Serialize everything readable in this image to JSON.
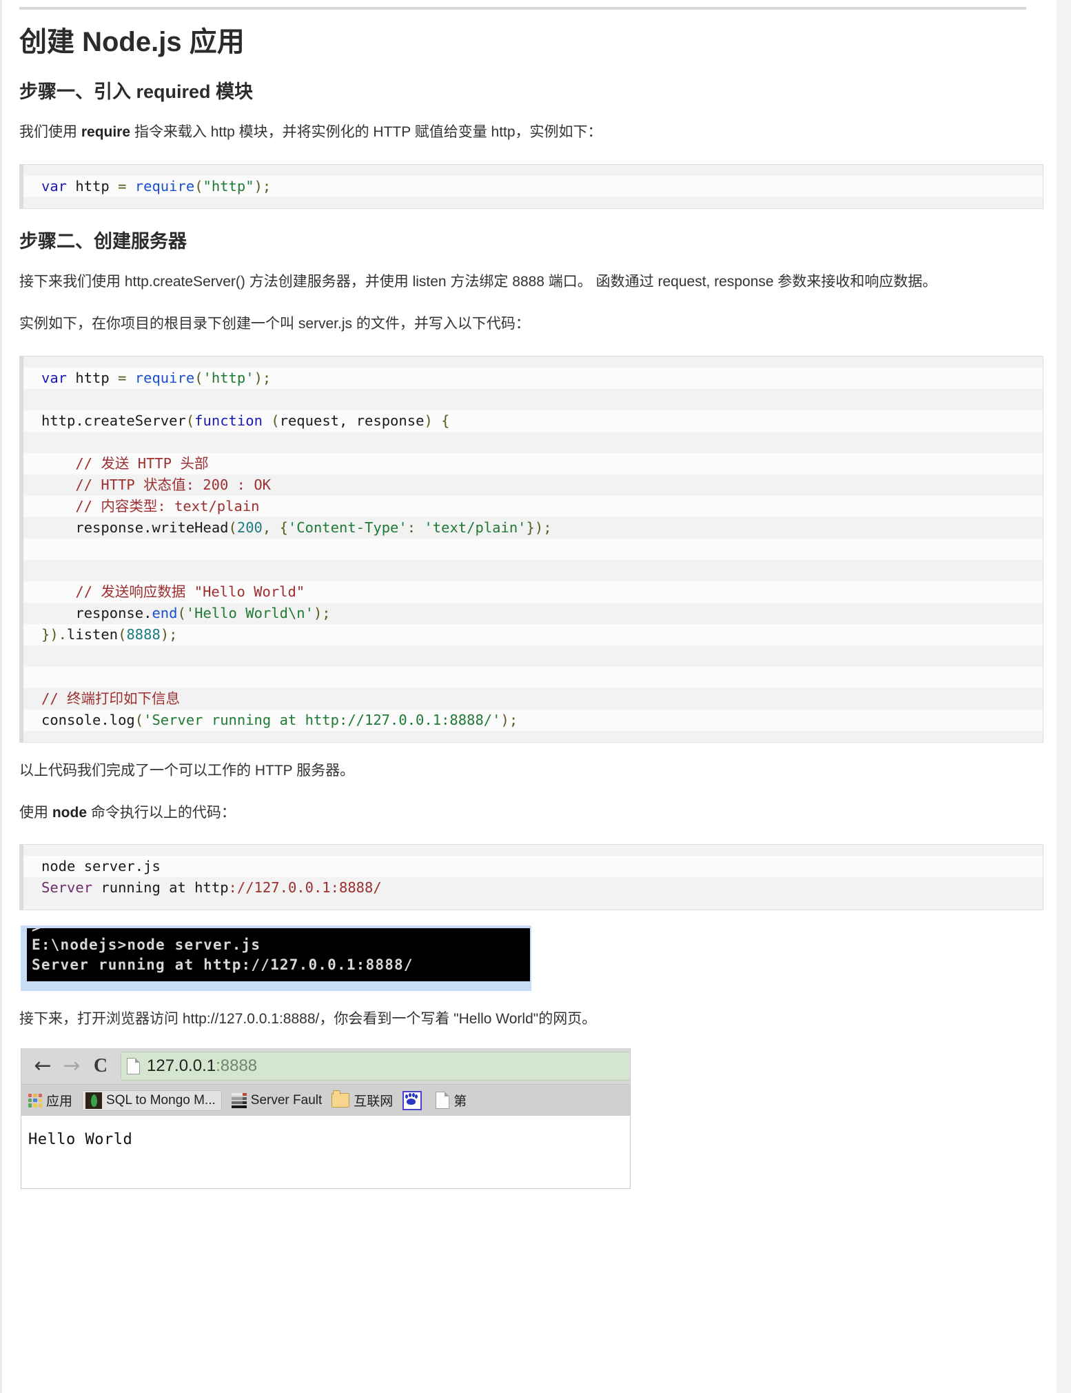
{
  "page": {
    "title": "创建 Node.js 应用"
  },
  "sections": [
    {
      "heading": "步骤一、引入 required 模块",
      "paragraph_prefix": "我们使用 ",
      "paragraph_bold": "require",
      "paragraph_suffix": " 指令来载入 http 模块，并将实例化的 HTTP 赋值给变量 http，实例如下："
    },
    {
      "heading": "步骤二、创建服务器",
      "paragraph1": "接下来我们使用 http.createServer() 方法创建服务器，并使用 listen 方法绑定 8888 端口。 函数通过 request, response 参数来接收和响应数据。",
      "paragraph2": "实例如下，在你项目的根目录下创建一个叫 server.js 的文件，并写入以下代码："
    }
  ],
  "code_block_1": {
    "lines": [
      "var http = require(\"http\");"
    ]
  },
  "code_block_2": {
    "lines": [
      "var http = require('http');",
      "",
      "http.createServer(function (request, response) {",
      "",
      "    // 发送 HTTP 头部",
      "    // HTTP 状态值: 200 : OK",
      "    // 内容类型: text/plain",
      "    response.writeHead(200, {'Content-Type': 'text/plain'});",
      "",
      "    // 发送响应数据 \"Hello World\"",
      "    response.end('Hello World\\n');",
      "}).listen(8888);",
      "",
      "// 终端打印如下信息",
      "console.log('Server running at http://127.0.0.1:8888/');"
    ]
  },
  "after_code": {
    "paragraph1": "以上代码我们完成了一个可以工作的 HTTP 服务器。",
    "paragraph2_prefix": "使用 ",
    "paragraph2_bold": "node",
    "paragraph2_suffix": " 命令执行以上的代码："
  },
  "code_block_3": {
    "line1": "node server.js",
    "line2_name": "Server",
    "line2_mid": " running at ",
    "line2_url_prefix": "http",
    "line2_url_rest": "://127.0.0.1:8888/"
  },
  "terminal_shot": {
    "line1": "E:\\nodejs>node server.js",
    "line2": "Server running at http://127.0.0.1:8888/"
  },
  "browser_intro": "接下来，打开浏览器访问 http://127.0.0.1:8888/，你会看到一个写着 \"Hello World\"的网页。",
  "browser_shot": {
    "back_glyph": "←",
    "forward_glyph": "→",
    "reload_glyph": "C",
    "url_host": "127.0.0.1",
    "url_port": ":8888",
    "bookmarks": [
      {
        "label": "应用",
        "icon": "apps-grid-icon"
      },
      {
        "label": "SQL to Mongo M...",
        "icon": "mongodb-icon"
      },
      {
        "label": "Server Fault",
        "icon": "server-fault-icon"
      },
      {
        "label": "互联网",
        "icon": "folder-icon"
      },
      {
        "label": "",
        "icon": "baidu-paw-icon"
      },
      {
        "label": "第",
        "icon": "page-doc-icon"
      }
    ],
    "content": "Hello World"
  },
  "colors": {
    "keyword": "#1a1ab3",
    "string": "#1f7a34",
    "comment": "#9d2f2f",
    "number": "#1d7c82",
    "function": "#1a4fd0",
    "code_bg_odd": "#f2f2f2",
    "code_bg_even": "#fbfbfb",
    "omnibox_bg": "#d4e6cf",
    "terminal_bg": "#000000",
    "terminal_frame": "#c7dcf5"
  }
}
